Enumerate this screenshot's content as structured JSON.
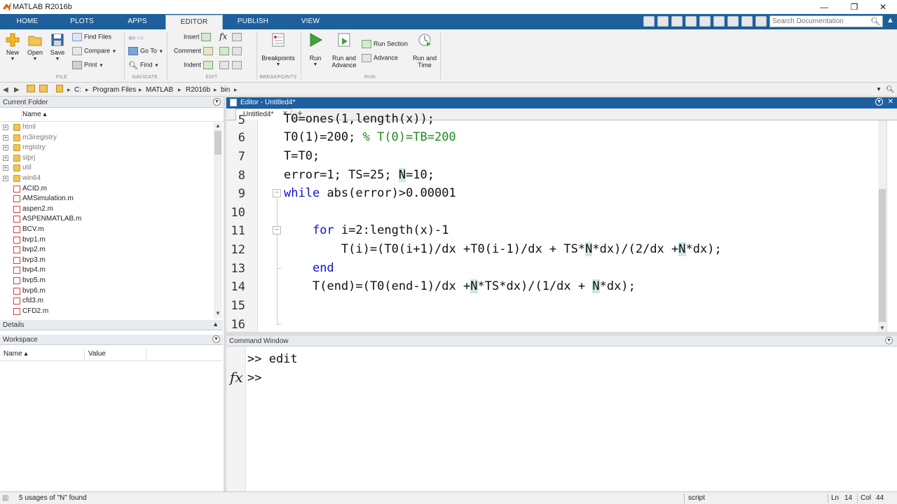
{
  "window": {
    "title": "MATLAB R2016b",
    "controls": [
      "—",
      "❐",
      "✕"
    ]
  },
  "ribbon_tabs": [
    {
      "label": "HOME"
    },
    {
      "label": "PLOTS"
    },
    {
      "label": "APPS"
    },
    {
      "label": "EDITOR"
    },
    {
      "label": "PUBLISH"
    },
    {
      "label": "VIEW"
    }
  ],
  "search": {
    "placeholder": "Search Documentation"
  },
  "ribbon": {
    "file": {
      "label": "FILE",
      "new": "New",
      "open": "Open",
      "save": "Save",
      "find_files": "Find Files",
      "compare": "Compare",
      "print": "Print"
    },
    "navigate": {
      "label": "NAVIGATE",
      "go_to": "Go To",
      "find": "Find"
    },
    "edit": {
      "label": "EDIT",
      "insert": "Insert",
      "comment": "Comment",
      "indent": "Indent",
      "fx": "fx"
    },
    "breakpoints": {
      "label": "BREAKPOINTS",
      "breakpoints": "Breakpoints"
    },
    "run": {
      "label": "RUN",
      "run": "Run",
      "run_and_advance_1": "Run and",
      "run_and_advance_2": "Advance",
      "run_section": "Run Section",
      "advance": "Advance",
      "run_and_time_1": "Run and",
      "run_and_time_2": "Time"
    }
  },
  "address": {
    "crumbs": [
      "C:",
      "Program Files",
      "MATLAB",
      "R2016b",
      "bin"
    ]
  },
  "current_folder": {
    "title": "Current Folder",
    "column": "Name ▴",
    "items": [
      {
        "name": "html",
        "type": "folder"
      },
      {
        "name": "m3iregistry",
        "type": "folder"
      },
      {
        "name": "registry",
        "type": "folder"
      },
      {
        "name": "slprj",
        "type": "folder"
      },
      {
        "name": "util",
        "type": "folder"
      },
      {
        "name": "win64",
        "type": "folder"
      },
      {
        "name": "ACID.m",
        "type": "m"
      },
      {
        "name": "AMSimulation.m",
        "type": "m"
      },
      {
        "name": "aspen2.m",
        "type": "m"
      },
      {
        "name": "ASPENMATLAB.m",
        "type": "m"
      },
      {
        "name": "BCV.m",
        "type": "m"
      },
      {
        "name": "bvp1.m",
        "type": "m"
      },
      {
        "name": "bvp2.m",
        "type": "m"
      },
      {
        "name": "bvp3.m",
        "type": "m"
      },
      {
        "name": "bvp4.m",
        "type": "m"
      },
      {
        "name": "bvp5.m",
        "type": "m"
      },
      {
        "name": "bvp6.m",
        "type": "m"
      },
      {
        "name": "cfd3.m",
        "type": "m"
      },
      {
        "name": "CFD2.m",
        "type": "m"
      }
    ]
  },
  "details": {
    "title": "Details"
  },
  "workspace": {
    "title": "Workspace",
    "col_name": "Name ▴",
    "col_value": "Value"
  },
  "editor": {
    "header": "Editor - Untitled4*",
    "tab": "Untitled4*",
    "tab_close": "✕",
    "add_tab": "+",
    "lines": [
      {
        "num": "5",
        "text": "T0=ones(1,length(x));"
      },
      {
        "num": "6",
        "text": "T0(1)=200; % T(0)=TB=200"
      },
      {
        "num": "7",
        "text": "T=T0;"
      },
      {
        "num": "8",
        "text": "error=1; TS=25; N=10;"
      },
      {
        "num": "9",
        "text": "while abs(error)>0.00001"
      },
      {
        "num": "10",
        "text": ""
      },
      {
        "num": "11",
        "text": "    for i=2:length(x)-1"
      },
      {
        "num": "12",
        "text": "        T(i)=(T0(i+1)/dx +T0(i-1)/dx + TS*N*dx)/(2/dx +N*dx);"
      },
      {
        "num": "13",
        "text": "    end"
      },
      {
        "num": "14",
        "text": "    T(end)=(T0(end-1)/dx +N*TS*dx)/(1/dx + N*dx);"
      },
      {
        "num": "15",
        "text": ""
      },
      {
        "num": "16",
        "text": ""
      }
    ]
  },
  "command_window": {
    "title": "Command Window",
    "lines": [
      ">> edit",
      ">>"
    ],
    "fx": "fx"
  },
  "status": {
    "message": "5 usages of \"N\" found",
    "mode": "script",
    "ln_label": "Ln",
    "ln": "14",
    "col_label": "Col",
    "col": "44"
  },
  "colors": {
    "tabstrip": "#1f5f9c",
    "keyword": "#1010d0",
    "comment": "#228b22",
    "editor_header": "#1d5fa0"
  }
}
